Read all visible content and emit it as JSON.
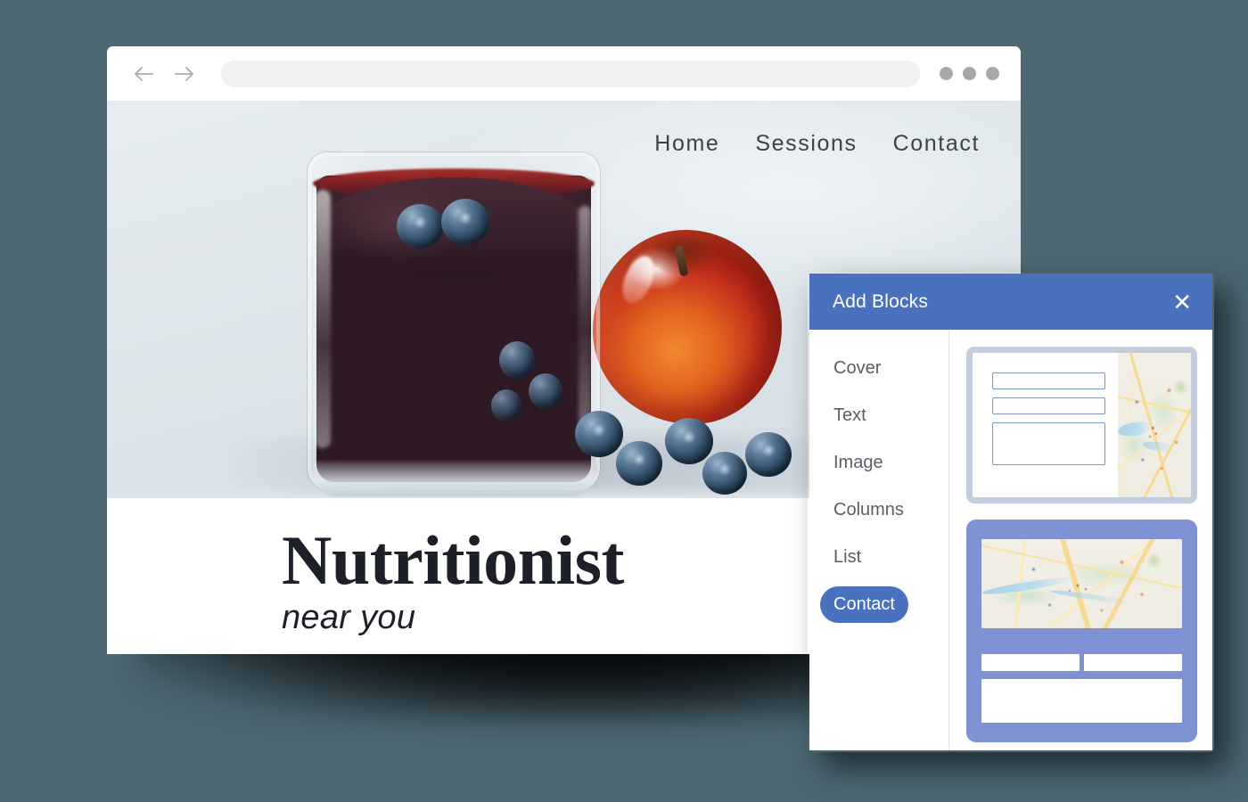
{
  "theme": {
    "page_background": "#4d6873",
    "panel_header_blue": "#4a71bd",
    "preview_card_blue": "#7f92d4",
    "preview_card_border": "#c3cddd",
    "headline_color": "#1d2029"
  },
  "browser": {
    "back_icon": "arrow-left-icon",
    "forward_icon": "arrow-right-icon",
    "url_value": "",
    "url_placeholder": "",
    "menu_dots": [
      "dot",
      "dot",
      "dot"
    ]
  },
  "site": {
    "nav": [
      {
        "label": "Home"
      },
      {
        "label": "Sessions"
      },
      {
        "label": "Contact"
      }
    ],
    "hero_image_alt": "Blueberry smoothie in a glass beside a red apple and scattered blueberries",
    "headline": "Nutritionist",
    "subhead": "near you"
  },
  "panel": {
    "title": "Add Blocks",
    "close_icon": "close-icon",
    "blocks": [
      {
        "label": "Cover",
        "active": false
      },
      {
        "label": "Text",
        "active": false
      },
      {
        "label": "Image",
        "active": false
      },
      {
        "label": "Columns",
        "active": false
      },
      {
        "label": "List",
        "active": false
      },
      {
        "label": "Contact",
        "active": true
      }
    ],
    "previews": [
      {
        "name": "contact-form-with-side-map",
        "style": "light",
        "fields": [
          "name-field",
          "email-field",
          "message-field"
        ],
        "map": "map-thumbnail"
      },
      {
        "name": "map-above-contact-form",
        "style": "blue",
        "map": "map-thumbnail",
        "fields": [
          "name-field",
          "email-field",
          "message-field"
        ]
      }
    ]
  }
}
